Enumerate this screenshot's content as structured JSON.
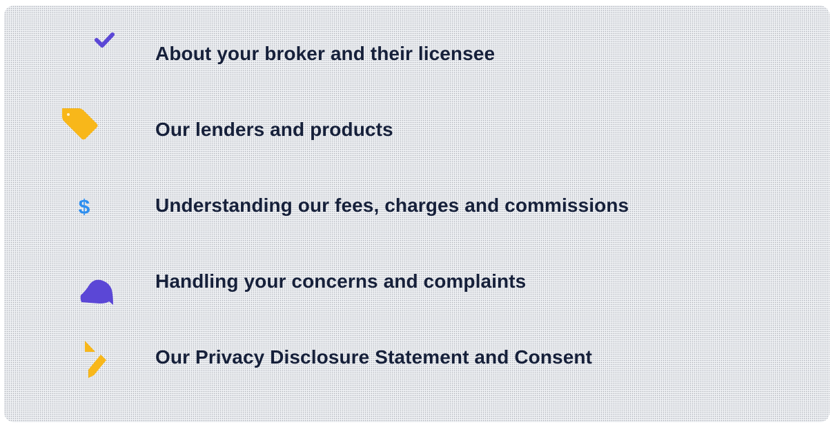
{
  "items": [
    {
      "label": "About your broker and their licensee",
      "icon": "check-icon",
      "color": "#5b47d6"
    },
    {
      "label": "Our lenders and products",
      "icon": "price-tag-icon",
      "color": "#f8b71a"
    },
    {
      "label": "Understanding our fees, charges and commissions",
      "icon": "dollar-icon",
      "color": "#2e8ff0"
    },
    {
      "label": "Handling your concerns and complaints",
      "icon": "speech-bubble-icon",
      "color": "#5b47d6"
    },
    {
      "label": "Our Privacy Disclosure Statement and Consent",
      "icon": "pencil-icon",
      "color": "#f8b71a"
    }
  ]
}
